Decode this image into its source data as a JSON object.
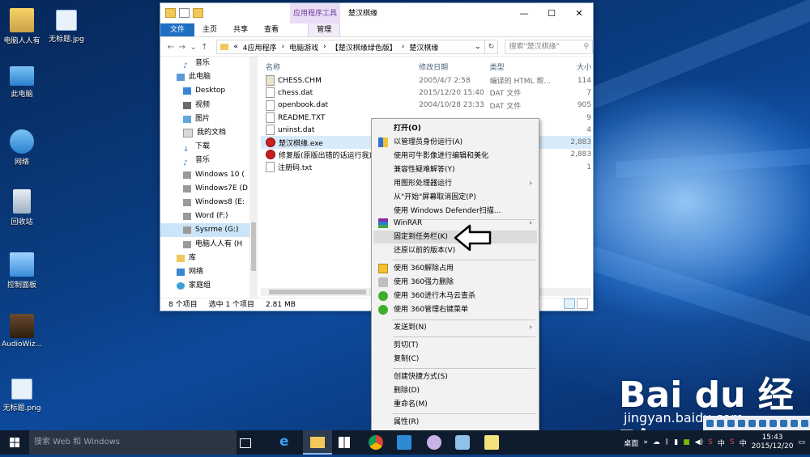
{
  "desktop": {
    "icons": [
      {
        "label": "电脑人人有"
      },
      {
        "label": "无标题.jpg"
      },
      {
        "label": "此电脑"
      },
      {
        "label": "网络"
      },
      {
        "label": "回收站"
      },
      {
        "label": "控制面板"
      },
      {
        "label": "AudioWiz..."
      },
      {
        "label": "无标题.png"
      }
    ]
  },
  "explorer": {
    "title": "楚汉棋缘",
    "context_tab": "应用程序工具",
    "window_controls": {
      "minimize": "—",
      "maximize": "☐",
      "close": "✕"
    },
    "ribbon_tabs": [
      "文件",
      "主页",
      "共享",
      "查看",
      "管理"
    ],
    "nav_buttons": {
      "back": "←",
      "forward": "→",
      "up_history": "⌄",
      "up": "↑"
    },
    "breadcrumb": [
      "«",
      "4应用程序",
      "›",
      "电脑游戏",
      "›",
      "【楚汉棋缘绿色版】",
      "›",
      "楚汉棋缘"
    ],
    "address_dropdown": "⌄",
    "refresh": "↻",
    "search_placeholder": "搜索\"楚汉棋缘\"",
    "nav_items": [
      {
        "label": "音乐"
      },
      {
        "label": "此电脑"
      },
      {
        "label": "Desktop"
      },
      {
        "label": "视频"
      },
      {
        "label": "图片"
      },
      {
        "label": "我的文档"
      },
      {
        "label": "下载"
      },
      {
        "label": "音乐"
      },
      {
        "label": "Windows 10 ("
      },
      {
        "label": "Windows7E (D"
      },
      {
        "label": "Windows8 (E:"
      },
      {
        "label": "Word (F:)"
      },
      {
        "label": "Sysrme (G:)"
      },
      {
        "label": "电脑人人有 (H"
      },
      {
        "label": "库"
      },
      {
        "label": "网络"
      },
      {
        "label": "家庭组"
      }
    ],
    "columns": {
      "name": "名称",
      "date": "修改日期",
      "type": "类型",
      "size": "大小"
    },
    "files": [
      {
        "name": "CHESS.CHM",
        "date": "2005/4/7 2:58",
        "type": "编译的 HTML 帮...",
        "size": "114"
      },
      {
        "name": "chess.dat",
        "date": "2015/12/20 15:40",
        "type": "DAT 文件",
        "size": "7"
      },
      {
        "name": "openbook.dat",
        "date": "2004/10/28 23:33",
        "type": "DAT 文件",
        "size": "905"
      },
      {
        "name": "README.TXT",
        "date": "",
        "type": "",
        "size": "9"
      },
      {
        "name": "uninst.dat",
        "date": "",
        "type": "",
        "size": "4"
      },
      {
        "name": "楚汉棋缘.exe",
        "date": "",
        "type": "",
        "size": "2,883"
      },
      {
        "name": "修复版(原版出错的话运行我).e",
        "date": "",
        "type": "",
        "size": "2,883"
      },
      {
        "name": "注册码.txt",
        "date": "",
        "type": "",
        "size": "1"
      }
    ],
    "status": {
      "count": "8 个项目",
      "selected": "选中 1 个项目",
      "size": "2.81 MB"
    }
  },
  "context_menu": {
    "items": [
      {
        "label": "打开(O)",
        "bold": true
      },
      {
        "label": "以管理员身份运行(A)",
        "icon": "uac-shield-icon"
      },
      {
        "label": "使用可牛影像进行编辑和美化"
      },
      {
        "label": "兼容性疑难解答(Y)"
      },
      {
        "label": "用图形处理器运行",
        "submenu": true
      },
      {
        "label": "从\"开始\"屏幕取消固定(P)"
      },
      {
        "label": "使用 Windows Defender扫描..."
      },
      {
        "label": "WinRAR",
        "icon": "winrar-icon",
        "submenu": true
      },
      {
        "label": "固定到任务栏(K)",
        "highlight": true
      },
      {
        "label": "还原以前的版本(V)"
      },
      {
        "label": "使用 360解除占用",
        "icon": "folder-lock-icon"
      },
      {
        "label": "使用 360强力删除",
        "icon": "shredder-icon"
      },
      {
        "label": "使用 360进行木马云查杀",
        "icon": "360-icon"
      },
      {
        "label": "使用 360管理右键菜单",
        "icon": "360-icon"
      },
      {
        "label": "发送到(N)",
        "submenu": true
      },
      {
        "label": "剪切(T)"
      },
      {
        "label": "复制(C)"
      },
      {
        "label": "创建快捷方式(S)"
      },
      {
        "label": "删除(D)"
      },
      {
        "label": "重命名(M)"
      },
      {
        "label": "属性(R)"
      }
    ],
    "submenu_arrow": "›"
  },
  "taskbar": {
    "search_placeholder": "搜索 Web 和 Windows",
    "desktop_label": "桌面",
    "tray_text_1": "中",
    "tray_text_2": "中",
    "time": "15:43",
    "date": "2015/12/20"
  },
  "watermark": {
    "brand": "Bai du 经验",
    "url": "jingyan.baidu.com"
  },
  "colors": {
    "accent": "#1e6fc4",
    "selection": "#cce4f7",
    "taskbar": "#0e1c2e",
    "desktop": "#0b3f86"
  }
}
